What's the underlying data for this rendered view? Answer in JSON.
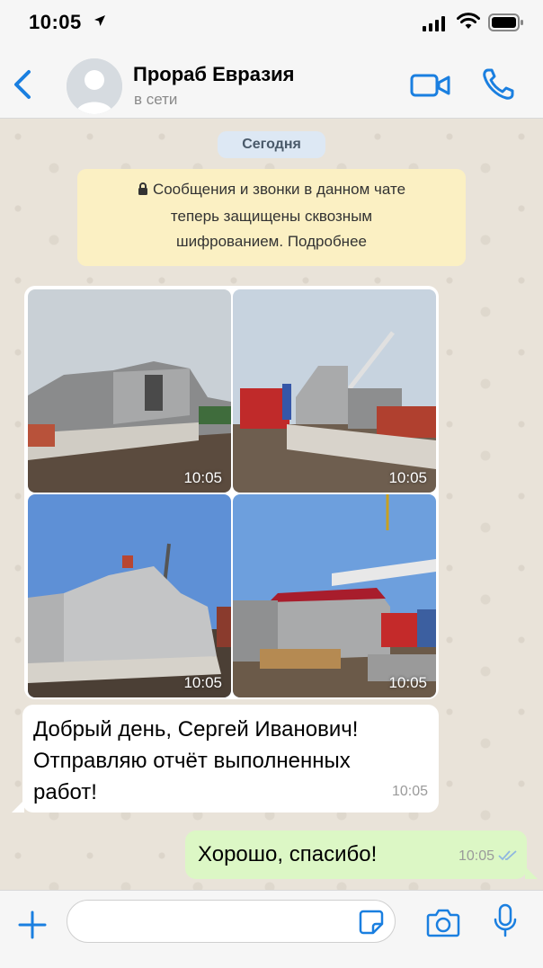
{
  "status_bar": {
    "time": "10:05"
  },
  "header": {
    "contact_name": "Прораб Евразия",
    "contact_status": "в сети"
  },
  "chat": {
    "date_label": "Сегодня",
    "encryption_notice": {
      "lines": [
        "Сообщения и звонки в данном чате",
        "теперь защищены сквозным",
        "шифрованием. Подробнее"
      ]
    },
    "photos": [
      {
        "icon": "construction-photo-1",
        "time": "10:05"
      },
      {
        "icon": "construction-photo-2",
        "time": "10:05"
      },
      {
        "icon": "construction-photo-3",
        "time": "10:05"
      },
      {
        "icon": "construction-photo-4",
        "time": "10:05"
      }
    ],
    "incoming_message": {
      "lines": [
        "Добрый день, Сергей Иванович!",
        "Отправляю отчёт выполненных",
        "работ!"
      ],
      "time": "10:05"
    },
    "outgoing_message": {
      "text": "Хорошо, спасибо!",
      "time": "10:05",
      "read_status": "read"
    }
  },
  "input": {
    "placeholder": ""
  },
  "colors": {
    "accent": "#1a7fe0",
    "outgoing_bubble": "#dcf7c5",
    "notice_bg": "#fbf0c3",
    "date_pill_bg": "#dde8f4",
    "chat_bg": "#e9e3d9"
  }
}
